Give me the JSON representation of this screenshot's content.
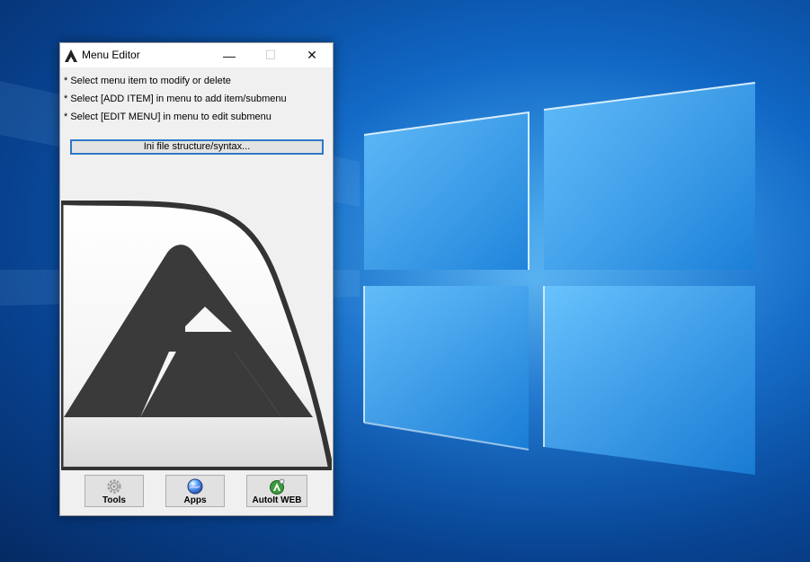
{
  "window": {
    "title": "Menu Editor",
    "minimize_glyph": "—",
    "maximize_glyph": "☐",
    "close_glyph": "✕"
  },
  "hints": [
    "* Select menu item to modify or delete",
    "* Select [ADD ITEM] in menu to add item/submenu",
    "* Select [EDIT MENU] in menu to edit submenu"
  ],
  "ini_button_label": "Ini file structure/syntax...",
  "buttons": {
    "tools": {
      "label": "Tools",
      "icon": "gear-icon"
    },
    "apps": {
      "label": "Apps",
      "icon": "globe-icon"
    },
    "web": {
      "label": "AutoIt WEB",
      "icon": "autoit-web-icon"
    }
  },
  "colors": {
    "window_bg": "#f0f0f0",
    "accent_border": "#2f78c7",
    "logo_dark": "#3a3a3a",
    "desktop_blue": "#0f66c4"
  }
}
